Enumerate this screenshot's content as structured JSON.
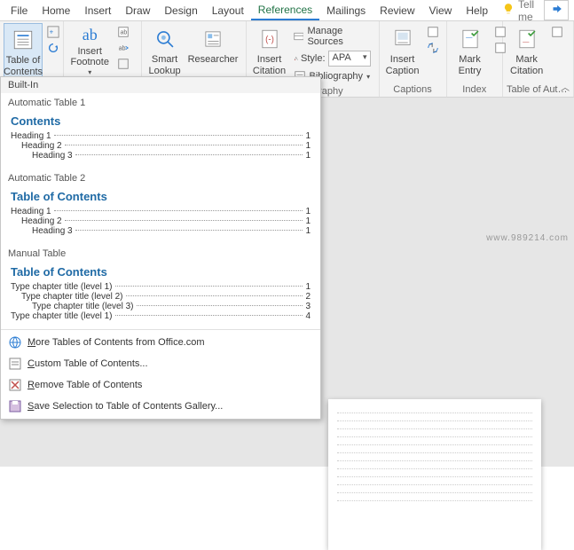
{
  "tabs": {
    "file": "File",
    "home": "Home",
    "insert": "Insert",
    "draw": "Draw",
    "design": "Design",
    "layout": "Layout",
    "references": "References",
    "mailings": "Mailings",
    "review": "Review",
    "view": "View",
    "help": "Help",
    "tell_me": "Tell me"
  },
  "ribbon": {
    "toc": {
      "label": "Table of\nContents",
      "group": "Built-In"
    },
    "footnotes": {
      "insert_footnote": "Insert\nFootnote",
      "ab": "ab",
      "group": ""
    },
    "research": {
      "smart_lookup": "Smart\nLookup",
      "researcher": "Researcher",
      "group": ""
    },
    "citations": {
      "insert_citation": "Insert\nCitation",
      "manage_sources": "Manage Sources",
      "style_label": "Style:",
      "style_value": "APA",
      "bibliography": "Bibliography",
      "group": "s Bibliography"
    },
    "captions": {
      "insert_caption": "Insert\nCaption",
      "group": "Captions"
    },
    "index": {
      "mark_entry": "Mark\nEntry",
      "group": "Index"
    },
    "toa": {
      "mark_citation": "Mark\nCitation",
      "group": "Table of Auth..."
    }
  },
  "gallery": {
    "header": "Built-In",
    "auto1": {
      "title": "Automatic Table 1",
      "heading": "Contents",
      "rows": [
        {
          "text": "Heading 1",
          "page": "1",
          "indent": 0
        },
        {
          "text": "Heading 2",
          "page": "1",
          "indent": 1
        },
        {
          "text": "Heading 3",
          "page": "1",
          "indent": 2
        }
      ]
    },
    "auto2": {
      "title": "Automatic Table 2",
      "heading": "Table of Contents",
      "rows": [
        {
          "text": "Heading 1",
          "page": "1",
          "indent": 0
        },
        {
          "text": "Heading 2",
          "page": "1",
          "indent": 1
        },
        {
          "text": "Heading 3",
          "page": "1",
          "indent": 2
        }
      ]
    },
    "manual": {
      "title": "Manual Table",
      "heading": "Table of Contents",
      "rows": [
        {
          "text": "Type chapter title (level 1)",
          "page": "1",
          "indent": 0
        },
        {
          "text": "Type chapter title (level 2)",
          "page": "2",
          "indent": 1
        },
        {
          "text": "Type chapter title (level 3)",
          "page": "3",
          "indent": 2
        },
        {
          "text": "Type chapter title (level 1)",
          "page": "4",
          "indent": 0
        }
      ]
    },
    "footer": {
      "more": "More Tables of Contents from Office.com",
      "custom": "Custom Table of Contents...",
      "remove": "Remove Table of Contents",
      "save": "Save Selection to Table of Contents Gallery..."
    }
  },
  "watermark": "www.989214.com"
}
